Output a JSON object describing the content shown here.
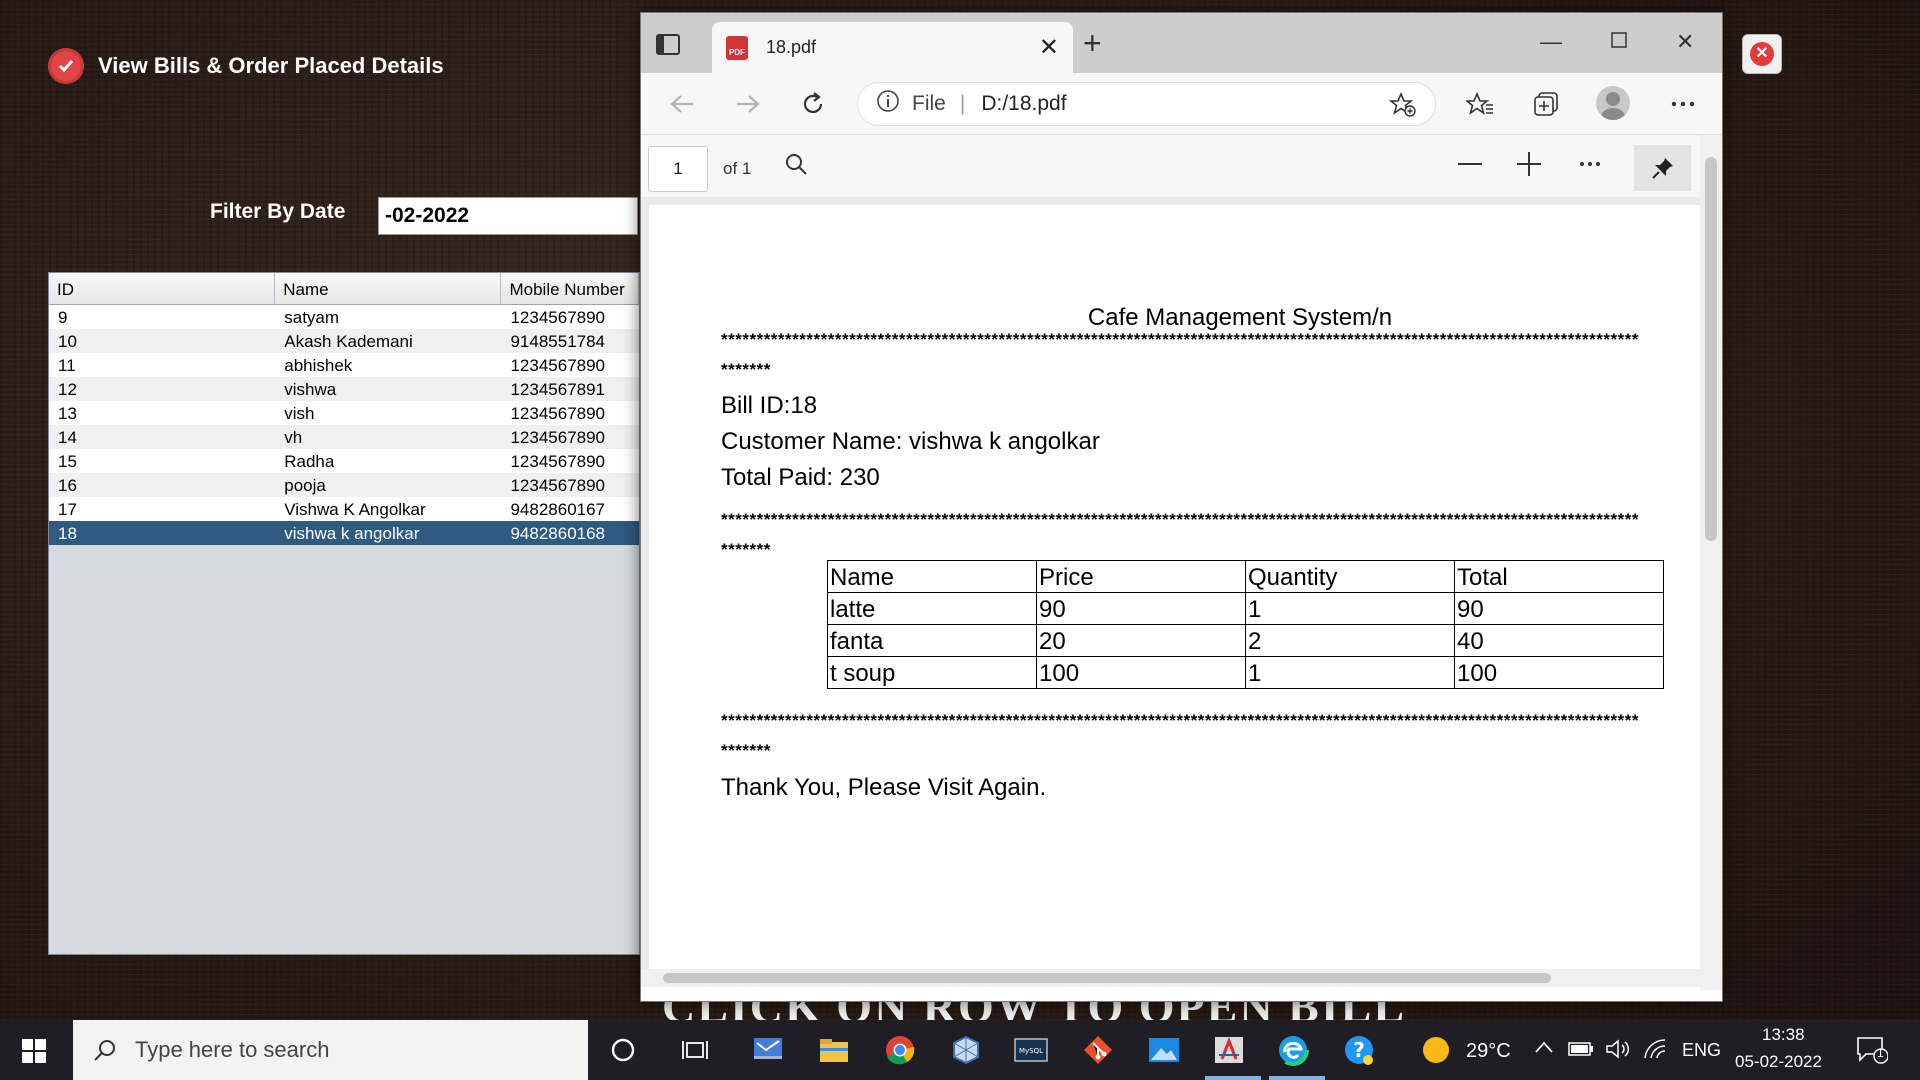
{
  "app": {
    "title": "View Bills & Order Placed Details",
    "filter_label": "Filter By Date",
    "filter_value": "-02-2022",
    "bottom_banner": "CLICK ON ROW TO OPEN BILL",
    "table": {
      "headers": [
        "ID",
        "Name",
        "Mobile Number"
      ],
      "rows": [
        {
          "id": "9",
          "name": "satyam",
          "mobile": "1234567890"
        },
        {
          "id": "10",
          "name": "Akash Kademani",
          "mobile": "9148551784"
        },
        {
          "id": "11",
          "name": "abhishek",
          "mobile": "1234567890"
        },
        {
          "id": "12",
          "name": "vishwa",
          "mobile": "1234567891"
        },
        {
          "id": "13",
          "name": "vish",
          "mobile": "1234567890"
        },
        {
          "id": "14",
          "name": "vh",
          "mobile": "1234567890"
        },
        {
          "id": "15",
          "name": "Radha",
          "mobile": "1234567890"
        },
        {
          "id": "16",
          "name": "pooja",
          "mobile": "1234567890"
        },
        {
          "id": "17",
          "name": "Vishwa K Angolkar",
          "mobile": "9482860167"
        },
        {
          "id": "18",
          "name": "vishwa k angolkar",
          "mobile": "9482860168"
        }
      ],
      "selected_id": "18"
    }
  },
  "browser": {
    "tab_title": "18.pdf",
    "address_prefix": "File",
    "address": "D:/18.pdf",
    "page_number": "1",
    "page_total": "of 1"
  },
  "pdf": {
    "title": "Cafe Management System/n",
    "stars": "*********************************************************************************************************************************",
    "stars_tail": "*******",
    "bill_id": "Bill ID:18",
    "customer": "Customer Name: vishwa k angolkar",
    "total": "Total Paid: 230",
    "table": {
      "headers": [
        "Name",
        "Price",
        "Quantity",
        "Total"
      ],
      "rows": [
        [
          "latte",
          "90",
          "1",
          "90"
        ],
        [
          "fanta",
          "20",
          "2",
          "40"
        ],
        [
          "t soup",
          "100",
          "1",
          "100"
        ]
      ]
    },
    "thanks": "Thank You, Please Visit Again."
  },
  "taskbar": {
    "search_placeholder": "Type here to search",
    "temperature": "29°C",
    "language": "ENG",
    "time": "13:38",
    "date": "05-02-2022",
    "notification_count": "1"
  },
  "colors": {
    "selected_row": "#2f5a81",
    "close_red": "#e23b3b",
    "taskbar": "#1e1e24"
  }
}
